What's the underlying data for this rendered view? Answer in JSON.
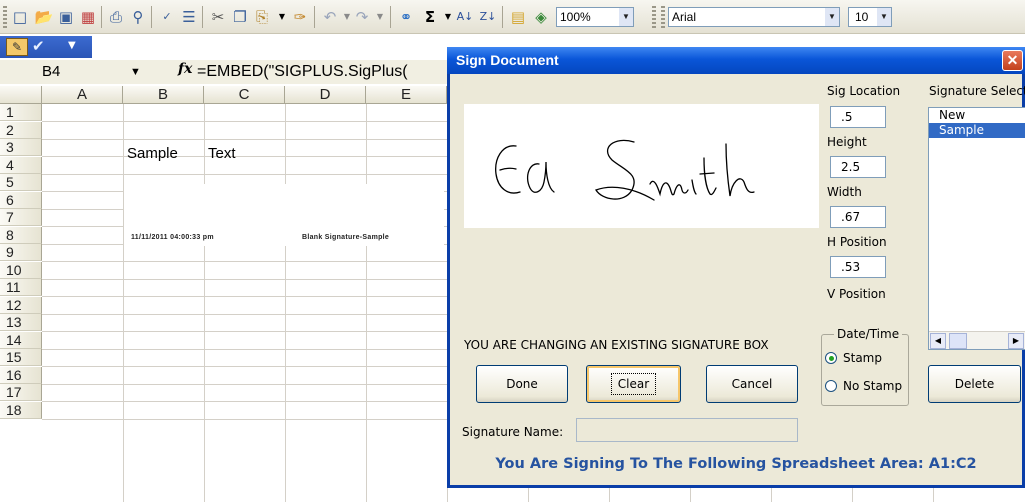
{
  "toolbar": {
    "zoom": "100%",
    "font_name": "Arial",
    "font_size": "10",
    "icons": [
      "new-icon",
      "open-icon",
      "save-icon",
      "permission-icon",
      "print-icon",
      "print-preview-icon",
      "spelling-icon",
      "research-icon",
      "cut-icon",
      "copy-icon",
      "paste-icon",
      "format-painter-icon",
      "undo-icon",
      "redo-icon",
      "hyperlink-icon",
      "autosum-icon",
      "sort-ascending-icon",
      "sort-descending-icon",
      "chart-wizard-icon",
      "drawing-icon"
    ]
  },
  "formula_bar": {
    "name_box": "B4",
    "fx_label": "fx",
    "formula": "=EMBED(\"SIGPLUS.SigPlus("
  },
  "sheet": {
    "columns": [
      "A",
      "B",
      "C",
      "D",
      "E"
    ],
    "rows": [
      "1",
      "2",
      "3",
      "4",
      "5",
      "6",
      "7",
      "8",
      "9",
      "10",
      "11",
      "12",
      "13",
      "14",
      "15",
      "16",
      "17",
      "18"
    ],
    "b2": "Sample",
    "c2": "Text",
    "stamp_text": "11/11/2011 04:00:33 pm",
    "stamp_label": "Blank Signature-Sample"
  },
  "dialog": {
    "title": "Sign Document",
    "signature_drawing": "Ed Smith",
    "labels": {
      "sig_location": "Sig Location",
      "height": "Height",
      "width": "Width",
      "h_position": "H Position",
      "v_position": "V Position",
      "signature_select": "Signature Select",
      "date_time": "Date/Time",
      "signature_name": "Signature Name:"
    },
    "fields": {
      "sig_location": ".5",
      "height": "2.5",
      "width": ".67",
      "h_position": ".53"
    },
    "signature_list": [
      {
        "label": "New",
        "selected": false
      },
      {
        "label": "Sample",
        "selected": true
      }
    ],
    "radios": {
      "stamp": {
        "label": "Stamp",
        "checked": true
      },
      "no_stamp": {
        "label": "No Stamp",
        "checked": false
      }
    },
    "status": "YOU ARE CHANGING AN EXISTING SIGNATURE BOX",
    "buttons": {
      "done": "Done",
      "clear": "Clear",
      "cancel": "Cancel",
      "delete": "Delete"
    },
    "signature_name_value": "",
    "footer": "You Are Signing To The Following Spreadsheet Area: A1:C2"
  },
  "colors": {
    "title_bar": "#0a56d8",
    "list_selection": "#316ac5",
    "footer_text": "#2653a0",
    "dialog_bg": "#ece9d8"
  }
}
